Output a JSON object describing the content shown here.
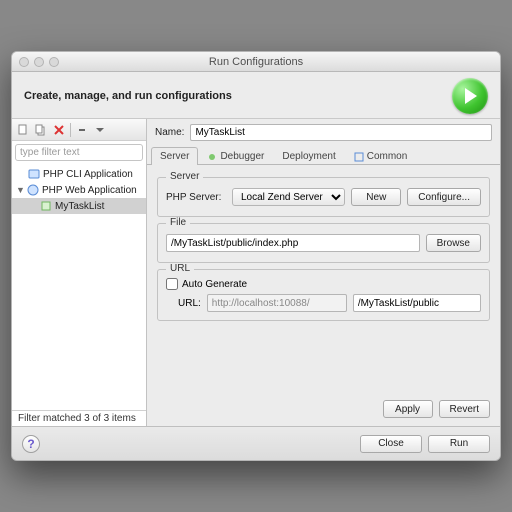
{
  "window": {
    "title": "Run Configurations"
  },
  "header": {
    "title": "Create, manage, and run configurations"
  },
  "sidebar": {
    "filter_placeholder": "type filter text",
    "items": [
      {
        "label": "PHP CLI Application"
      },
      {
        "label": "PHP Web Application"
      },
      {
        "label": "MyTaskList"
      }
    ],
    "status": "Filter matched 3 of 3 items"
  },
  "form": {
    "name_label": "Name:",
    "name_value": "MyTaskList",
    "tabs": [
      {
        "label": "Server"
      },
      {
        "label": "Debugger"
      },
      {
        "label": "Deployment"
      },
      {
        "label": "Common"
      }
    ],
    "server_group": {
      "legend": "Server",
      "php_server_label": "PHP Server:",
      "php_server_value": "Local Zend Server",
      "new_btn": "New",
      "configure_btn": "Configure..."
    },
    "file_group": {
      "legend": "File",
      "path": "/MyTaskList/public/index.php",
      "browse_btn": "Browse"
    },
    "url_group": {
      "legend": "URL",
      "auto_label": "Auto Generate",
      "url_label": "URL:",
      "base": "http://localhost:10088/",
      "path": "/MyTaskList/public"
    },
    "apply_btn": "Apply",
    "revert_btn": "Revert"
  },
  "footer": {
    "close_btn": "Close",
    "run_btn": "Run"
  }
}
